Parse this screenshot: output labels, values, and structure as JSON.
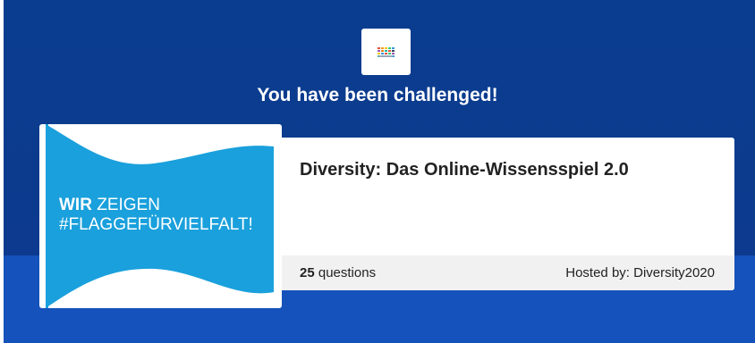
{
  "challenge": {
    "headline": "You have been challenged!"
  },
  "quiz": {
    "title": "Diversity: Das Online-Wissensspiel 2.0",
    "question_count": "25",
    "question_suffix": " questions",
    "host": "Hosted by: Diversity2020"
  },
  "cover": {
    "flag_line1_bold": "WIR",
    "flag_line1_rest": " ZEIGEN",
    "flag_line2": "#FLAGGEFÜRVIELFALT!"
  },
  "colors": {
    "background_top": "#0a3d8f",
    "background_bottom": "#1552bb",
    "flag": "#1aa0dc",
    "card": "#ffffff",
    "footer": "#f1f1f1"
  },
  "icons": {
    "logo": "diversity-charter-logo"
  }
}
